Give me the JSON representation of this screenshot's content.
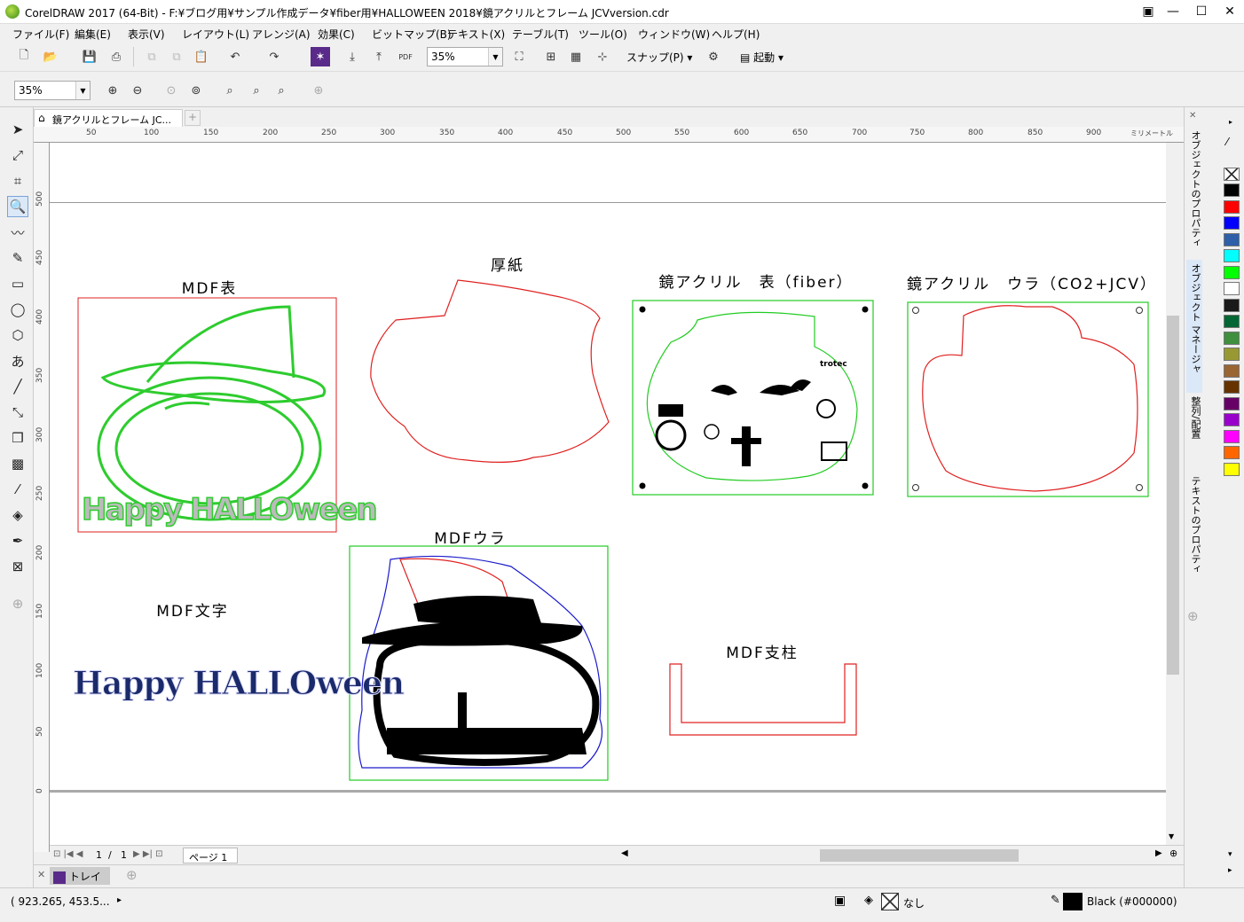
{
  "window": {
    "title": "CorelDRAW 2017 (64-Bit) - F:¥ブログ用¥サンプル作成データ¥fiber用¥HALLOWEEN 2018¥鏡アクリルとフレーム  JCVversion.cdr"
  },
  "menu": [
    "ファイル(F)",
    "編集(E)",
    "表示(V)",
    "レイアウト(L)",
    "アレンジ(A)",
    "効果(C)",
    "ビットマップ(B)",
    "テキスト(X)",
    "テーブル(T)",
    "ツール(O)",
    "ウィンドウ(W)",
    "ヘルプ(H)"
  ],
  "toolbar1": {
    "zoom": "35%",
    "snap_label": "スナップ(P)",
    "launch_label": "起動"
  },
  "toolbar2": {
    "zoom": "35%"
  },
  "document_tab": "鏡アクリルとフレーム  JC...",
  "ruler": {
    "h_ticks": [
      "50",
      "100",
      "150",
      "200",
      "250",
      "300",
      "350",
      "400",
      "450",
      "500",
      "550",
      "600",
      "650",
      "700",
      "750",
      "800",
      "850",
      "900"
    ],
    "unit": "ミリメートル",
    "v_ticks": [
      "500",
      "450",
      "400",
      "350",
      "300",
      "250",
      "200",
      "150",
      "100",
      "50",
      "0"
    ]
  },
  "canvas_labels": {
    "mdf_front": "MDF表",
    "cardboard": "厚紙",
    "acrylic_front": "鏡アクリル　表（fiber）",
    "acrylic_back": "鏡アクリル　ウラ（CO2+JCV）",
    "mdf_back": "MDFウラ",
    "mdf_text": "MDF文字",
    "mdf_support": "MDF支柱",
    "trotec": "trotec",
    "halloween_art": "Happy HALLOween"
  },
  "pagebar": {
    "current": "1",
    "separator": "/",
    "total": "1",
    "page_tab": "ページ 1"
  },
  "tray": {
    "label": "トレイ"
  },
  "status": {
    "coords": "( 923.265, 453.5...",
    "fill_label": "なし",
    "outline_label": "Black (#000000)"
  },
  "dockers": [
    "オブジェクトのプロパティ",
    "オブジェクト マネージャ",
    "整列/配置",
    "テキストのプロパティ"
  ],
  "palette": [
    "#000000",
    "#ff0000",
    "#0000ff",
    "#2e5fa8",
    "#00ffff",
    "#00ff00",
    "#ffffff",
    "#1a1a1a",
    "#006633",
    "#3f8f3f",
    "#999933",
    "#996633",
    "#663300",
    "#660066",
    "#9900cc",
    "#ff00ff",
    "#ff6600",
    "#ffff00"
  ],
  "colors": {
    "cut_red": "#e02020",
    "cut_green": "#22cc22",
    "cut_blue": "#1a1acc"
  }
}
